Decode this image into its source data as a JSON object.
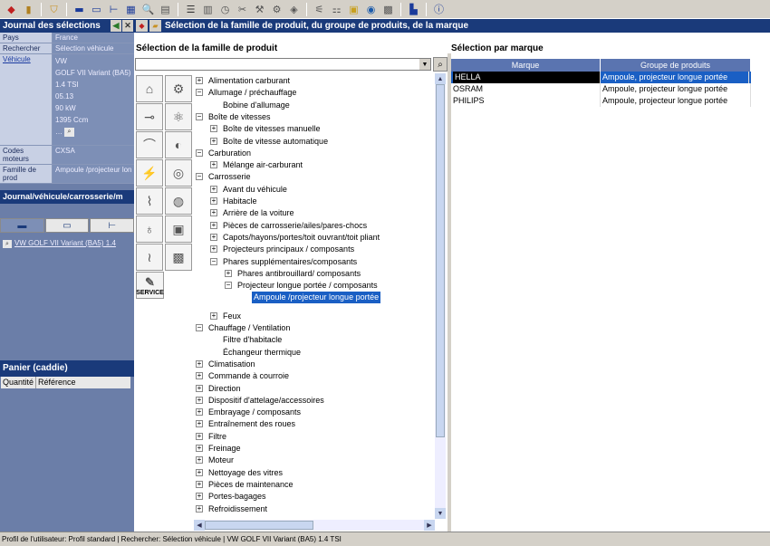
{
  "journal": {
    "title": "Journal des sélections",
    "rows": [
      {
        "key": "Pays",
        "value": "France"
      },
      {
        "key": "Rechercher",
        "value": "Sélection véhicule"
      }
    ],
    "vehicule_key": "Véhicule",
    "vehicule_lines": [
      "VW",
      "GOLF VII Variant (BA5)",
      "1.4 TSI",
      "05.13",
      "90 kW",
      "1395 Ccm"
    ],
    "codes_moteurs_key": "Codes moteurs",
    "codes_moteurs_value": "CXSA",
    "famille_key": "Famille de prod",
    "famille_value": "Ampoule /projecteur lon"
  },
  "journal2": {
    "title": "Journal/véhicule/carrosserie/m",
    "vehicle_link": "VW GOLF VII Variant (BA5) 1.4"
  },
  "panier": {
    "title": "Panier (caddie)",
    "col_quantite": "Quantité",
    "col_reference": "Référence"
  },
  "main": {
    "title": "Sélection de la famille de produit, du groupe de produits, de la marque",
    "left_label": "Sélection de la famille de produit",
    "right_label": "Sélection par marque"
  },
  "tree": [
    {
      "label": "Alimentation carburant",
      "level": 0,
      "expander": "+"
    },
    {
      "label": "Allumage / préchauffage",
      "level": 0,
      "expander": "-"
    },
    {
      "label": "Bobine d'allumage",
      "level": 1,
      "expander": ""
    },
    {
      "label": "Boîte de vitesses",
      "level": 0,
      "expander": "-"
    },
    {
      "label": "Boîte de vitesses manuelle",
      "level": 1,
      "expander": "+"
    },
    {
      "label": "Boîte de vitesse automatique",
      "level": 1,
      "expander": "+"
    },
    {
      "label": "Carburation",
      "level": 0,
      "expander": "-"
    },
    {
      "label": "Mélange air-carburant",
      "level": 1,
      "expander": "+"
    },
    {
      "label": "Carrosserie",
      "level": 0,
      "expander": "-"
    },
    {
      "label": "Avant du véhicule",
      "level": 1,
      "expander": "+"
    },
    {
      "label": "Habitacle",
      "level": 1,
      "expander": "+"
    },
    {
      "label": "Arrière de la voiture",
      "level": 1,
      "expander": "+"
    },
    {
      "label": "Pièces de carrosserie/ailes/pares-chocs",
      "level": 1,
      "expander": "+"
    },
    {
      "label": "Capots/hayons/portes/toit ouvrant/toit pliant",
      "level": 1,
      "expander": "+"
    },
    {
      "label": "Projecteurs principaux / composants",
      "level": 1,
      "expander": "+"
    },
    {
      "label": "Phares supplémentaires/composants",
      "level": 1,
      "expander": "-"
    },
    {
      "label": "Phares antibrouillard/ composants",
      "level": 2,
      "expander": "+"
    },
    {
      "label": "Projecteur longue portée / composants",
      "level": 2,
      "expander": "-"
    },
    {
      "label": "Ampoule /projecteur longue portée",
      "level": 3,
      "expander": "",
      "selected": true
    },
    {
      "label": "Feux",
      "level": 1,
      "expander": "+",
      "gap": true
    },
    {
      "label": "Chauffage / Ventilation",
      "level": 0,
      "expander": "-"
    },
    {
      "label": "Filtre d'habitacle",
      "level": 1,
      "expander": ""
    },
    {
      "label": "Échangeur thermique",
      "level": 1,
      "expander": ""
    },
    {
      "label": "Climatisation",
      "level": 0,
      "expander": "+"
    },
    {
      "label": "Commande à courroie",
      "level": 0,
      "expander": "+"
    },
    {
      "label": "Direction",
      "level": 0,
      "expander": "+"
    },
    {
      "label": "Dispositif d'attelage/accessoires",
      "level": 0,
      "expander": "+"
    },
    {
      "label": "Embrayage / composants",
      "level": 0,
      "expander": "+"
    },
    {
      "label": "Entraînement des roues",
      "level": 0,
      "expander": "+"
    },
    {
      "label": "Filtre",
      "level": 0,
      "expander": "+"
    },
    {
      "label": "Freinage",
      "level": 0,
      "expander": "+"
    },
    {
      "label": "Moteur",
      "level": 0,
      "expander": "+"
    },
    {
      "label": "Nettoyage des vitres",
      "level": 0,
      "expander": "+"
    },
    {
      "label": "Pièces de maintenance",
      "level": 0,
      "expander": "+"
    },
    {
      "label": "Portes-bagages",
      "level": 0,
      "expander": "+"
    },
    {
      "label": "Refroidissement",
      "level": 0,
      "expander": "+"
    }
  ],
  "brands": {
    "col_marque": "Marque",
    "col_groupe": "Groupe de produits",
    "rows": [
      {
        "marque": "HELLA",
        "groupe": "Ampoule, projecteur longue portée",
        "selected": true
      },
      {
        "marque": "OSRAM",
        "groupe": "Ampoule, projecteur longue portée"
      },
      {
        "marque": "PHILIPS",
        "groupe": "Ampoule, projecteur longue portée"
      }
    ]
  },
  "service_label": "SERVICE",
  "status": "Profil de l'utilisateur: Profil standard | Rechercher: Sélection véhicule | VW GOLF VII Variant (BA5) 1.4 TSI"
}
